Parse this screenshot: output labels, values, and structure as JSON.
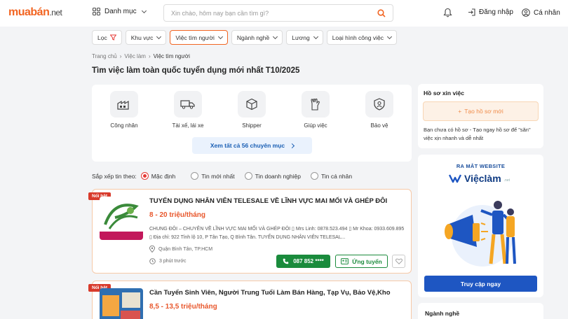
{
  "header": {
    "logo": {
      "part1": "mua",
      "part2": "bán",
      "part3": ".net"
    },
    "categories_label": "Danh mục",
    "search_placeholder": "Xin chào, hôm nay bạn cần tìm gì?",
    "login_label": "Đăng nhập",
    "account_label": "Cá nhân"
  },
  "filters": [
    {
      "label": "Lọc",
      "active": false
    },
    {
      "label": "Khu vực",
      "active": false
    },
    {
      "label": "Việc tìm người",
      "active": true
    },
    {
      "label": "Ngành nghề",
      "active": false
    },
    {
      "label": "Lương",
      "active": false
    },
    {
      "label": "Loại hình công việc",
      "active": false
    }
  ],
  "breadcrumb": [
    "Trang chủ",
    "Việc làm",
    "Việc tìm người"
  ],
  "page_title": "Tìm việc làm toàn quốc tuyển dụng mới nhất T10/2025",
  "categories": {
    "items": [
      {
        "label": "Công nhân",
        "icon": "factory-icon"
      },
      {
        "label": "Tài xế, lái xe",
        "icon": "truck-icon"
      },
      {
        "label": "Shipper",
        "icon": "package-icon"
      },
      {
        "label": "Giúp việc",
        "icon": "glove-icon"
      },
      {
        "label": "Bảo vệ",
        "icon": "shield-icon"
      }
    ],
    "see_all": "Xem tất cả 56 chuyên mục"
  },
  "sort": {
    "label": "Sắp xếp tin theo:",
    "options": [
      "Mặc định",
      "Tin mới nhất",
      "Tin doanh nghiệp",
      "Tin cá nhân"
    ],
    "selected": "Mặc định"
  },
  "listings": [
    {
      "badge": "Nổi bật",
      "title": "TUYỂN DỤNG NHÂN VIÊN TELESALE VỀ LĨNH VỰC MAI MỐI VÀ GHÉP ĐÔI",
      "salary": "8 - 20 triệu/tháng",
      "description": "CHUNG ĐÔI – CHUYÊN VỀ LĨNH VỰC MAI MỐI VÀ GHÉP ĐÔI ▯ Mrs Linh: 0878.523.494 ▯ Mr Khoa: 0933.609.895 ▯ Địa chỉ: 922 Tỉnh lộ 10, P Tân Tạo, Q Bình Tân. TUYỂN DỤNG NHÂN VIÊN TELESAL...",
      "location": "Quận Bình Tân, TP.HCM",
      "time": "3 phút trước",
      "phone": "087 852 ****",
      "apply_label": "Ứng tuyển"
    },
    {
      "badge": "Nổi bật",
      "title": "Cần Tuyển Sinh Viên, Người Trung Tuổi Làm Bán Hàng, Tạp Vụ, Bảo Vệ,Kho",
      "salary": "8,5 - 13,5 triệu/tháng"
    }
  ],
  "sidebar": {
    "profile_title": "Hồ sơ xin việc",
    "create_profile": "Tạo hồ sơ mới",
    "profile_text": "Bạn chưa có hồ sơ - Tạo ngay hồ sơ để \"săn\" việc xịn nhanh và dễ nhất",
    "promo_label": "RA MẮT WEBSITE",
    "promo_brand": "Việclàm",
    "promo_brand_suffix": ".net",
    "promo_button": "Truy cập ngay",
    "industry_title": "Ngành nghề"
  },
  "colors": {
    "brand_orange": "#f26522",
    "green": "#1a8b3c",
    "blue": "#1e56c2",
    "red": "#d83a2b"
  }
}
